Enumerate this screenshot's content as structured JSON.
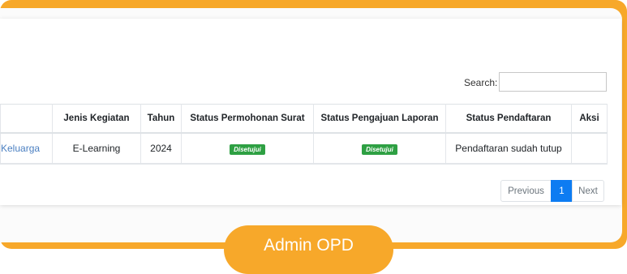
{
  "search": {
    "label": "Search:",
    "value": "",
    "placeholder": ""
  },
  "table": {
    "headers": [
      "",
      "Jenis Kegiatan",
      "Tahun",
      "Status Permohonan Surat",
      "Status Pengajuan Laporan",
      "Status Pendaftaran",
      "Aksi"
    ],
    "rows": [
      {
        "nama": "Keluarga",
        "jenis": "E-Learning",
        "tahun": "2024",
        "permohonan": "Disetujui",
        "laporan": "Disetujui",
        "pendaftaran": "Pendaftaran sudah tutup",
        "aksi": ""
      }
    ]
  },
  "pagination": {
    "previous": "Previous",
    "current": "1",
    "next": "Next"
  },
  "footer": {
    "pill_text": "Admin OPD"
  },
  "colors": {
    "accent": "#f7a82a",
    "badge": "#2ea043",
    "pager_active": "#0d7cf2",
    "link": "#4a7fc1"
  }
}
